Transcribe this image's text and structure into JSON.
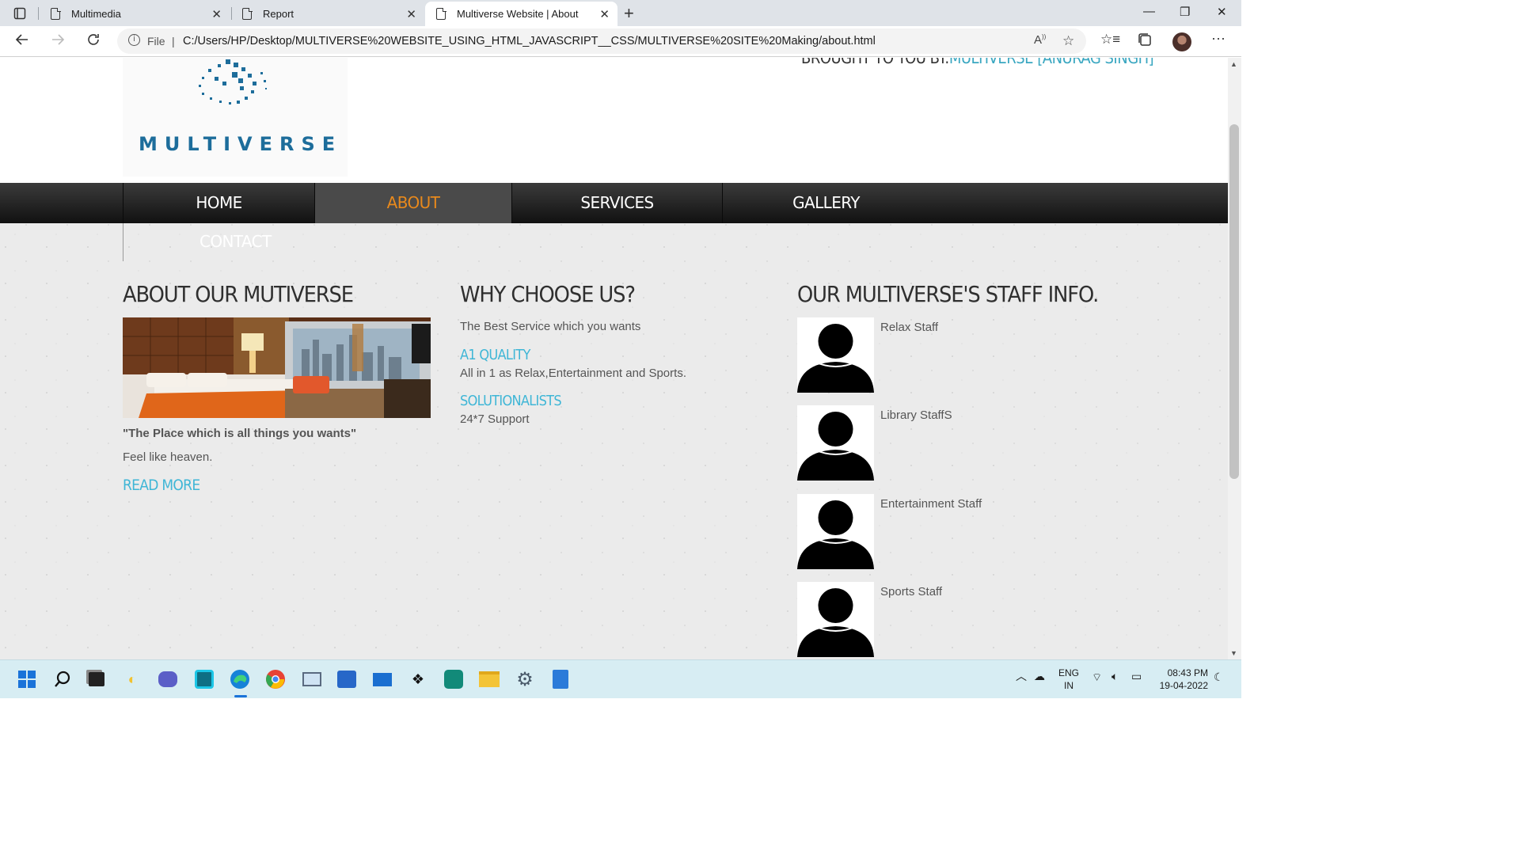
{
  "browser": {
    "tabs": [
      {
        "title": "Multimedia",
        "active": false
      },
      {
        "title": "Report",
        "active": false
      },
      {
        "title": "Multiverse Website | About",
        "active": true
      }
    ],
    "address": {
      "scheme_label": "File",
      "separator": "|",
      "url": "C:/Users/HP/Desktop/MULTIVERSE%20WEBSITE_USING_HTML_JAVASCRIPT__CSS/MULTIVERSE%20SITE%20Making/about.html"
    }
  },
  "site": {
    "logo_text": "MULTIVERSE",
    "brought_by": "BROUGHT TO YOU BY:",
    "author": "MULTIVERSE [ANURAG SINGH]",
    "nav": [
      {
        "label": "HOME",
        "active": false
      },
      {
        "label": "ABOUT",
        "active": true
      },
      {
        "label": "SERVICES",
        "active": false
      },
      {
        "label": "GALLERY",
        "active": false
      },
      {
        "label": "CONTACT",
        "active": false
      }
    ],
    "about": {
      "title": "ABOUT OUR MUTIVERSE",
      "quote": "\"The Place which is all things you wants\"",
      "text": "Feel like heaven.",
      "read_more": "READ MORE"
    },
    "why": {
      "title": "WHY CHOOSE US?",
      "intro": "The Best Service which you wants",
      "items": [
        {
          "heading": "A1 QUALITY",
          "text": "All in 1 as Relax,Entertainment and Sports."
        },
        {
          "heading": "SOLUTIONALISTS",
          "text": "24*7 Support"
        }
      ]
    },
    "staff": {
      "title": "OUR MULTIVERSE'S STAFF INFO.",
      "members": [
        {
          "name": "Relax Staff"
        },
        {
          "name": "Library StaffS"
        },
        {
          "name": "Entertainment Staff"
        },
        {
          "name": "Sports Staff"
        }
      ]
    }
  },
  "taskbar": {
    "lang_top": "ENG",
    "lang_bottom": "IN",
    "time": "08:43 PM",
    "date": "19-04-2022"
  },
  "colors": {
    "accent_orange": "#e8891c",
    "link_blue": "#3fb6d6",
    "logo_blue": "#1d6d9b"
  }
}
